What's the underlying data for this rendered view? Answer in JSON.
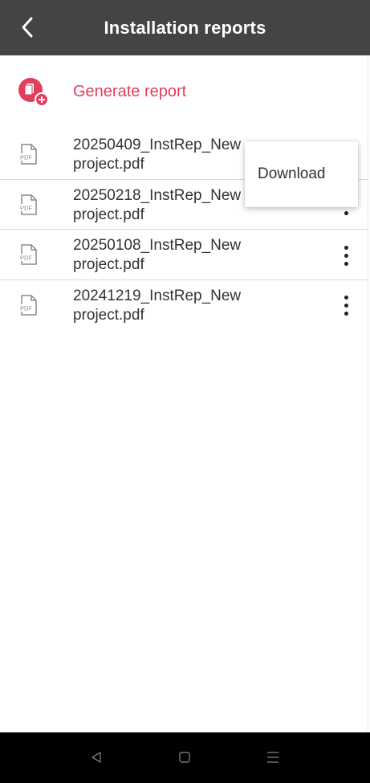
{
  "header": {
    "title": "Installation reports",
    "back_icon": "chevron-left-icon"
  },
  "generate": {
    "label": "Generate report",
    "icon": "document-add-icon",
    "accent": "#e23d5b"
  },
  "reports": [
    {
      "line1": "20250409_InstRep_New",
      "line2": "project.pdf"
    },
    {
      "line1": "20250218_InstRep_New",
      "line2": "project.pdf"
    },
    {
      "line1": "20250108_InstRep_New",
      "line2": "project.pdf"
    },
    {
      "line1": "20241219_InstRep_New",
      "line2": "project.pdf"
    }
  ],
  "pdf_icon_label": "PDF",
  "menu": {
    "download_label": "Download"
  },
  "navbar": {
    "icons": [
      "back-triangle-icon",
      "home-square-icon",
      "recents-lines-icon"
    ]
  },
  "colors": {
    "header_bg": "#444444",
    "accent": "#e23d5b",
    "navbar_bg": "#000000"
  }
}
